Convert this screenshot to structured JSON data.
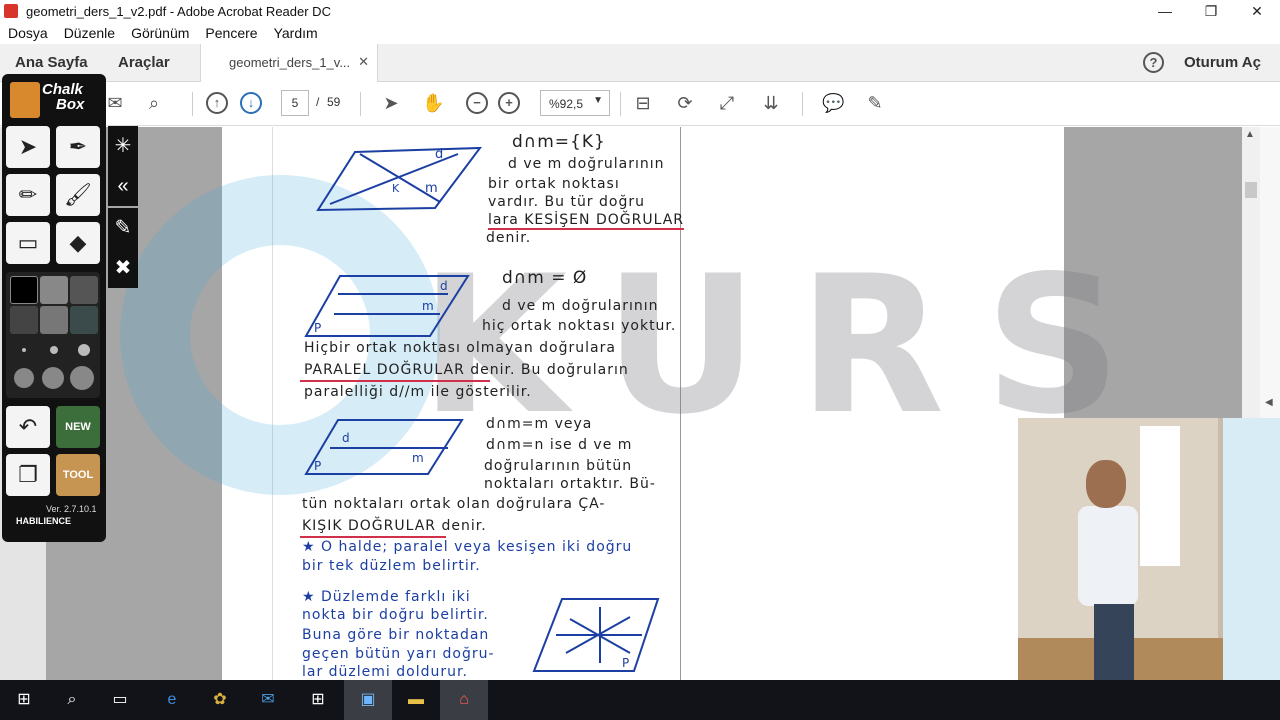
{
  "window": {
    "title": "geometri_ders_1_v2.pdf - Adobe Acrobat Reader DC",
    "controls": [
      "—",
      "❐",
      "✕"
    ]
  },
  "menu": [
    "Dosya",
    "Düzenle",
    "Görünüm",
    "Pencere",
    "Yardım"
  ],
  "tabs": {
    "home": "Ana Sayfa",
    "tools": "Araçlar",
    "document": "geometri_ders_1_v...",
    "help": "?",
    "sign_in": "Oturum Aç"
  },
  "toolbar": {
    "page_current": "5",
    "page_separator": "/",
    "page_total": "59",
    "zoom": "%92,5"
  },
  "document": {
    "watermark": "KURS",
    "notes": [
      {
        "text": "d∩m={K}"
      },
      {
        "text": "d ve m doğrularının"
      },
      {
        "text": "bir ortak noktası"
      },
      {
        "text": "vardır. Bu tür doğru"
      },
      {
        "text": "lara KESİŞEN DOĞRULAR"
      },
      {
        "text": "denir."
      },
      {
        "text": "d∩m = Ø"
      },
      {
        "text": "d ve m doğrularının"
      },
      {
        "text": "hiç ortak noktası yoktur."
      },
      {
        "text": "Hiçbir ortak noktası olmayan doğrulara"
      },
      {
        "text": "PARALEL DOĞRULAR denir. Bu doğruların"
      },
      {
        "text": "paralelliği d//m ile gösterilir."
      },
      {
        "text": "d∩m=m veya"
      },
      {
        "text": "d∩m=n ise d ve m"
      },
      {
        "text": "doğrularının bütün"
      },
      {
        "text": "noktaları ortaktır. Bü-"
      },
      {
        "text": "tün noktaları ortak olan doğrulara ÇA-"
      },
      {
        "text": "KIŞIK DOĞRULAR denir."
      },
      {
        "text": "★ O halde; paralel veya kesişen iki doğru"
      },
      {
        "text": "bir tek düzlem belirtir."
      },
      {
        "text": "★ Düzlemde farklı iki"
      },
      {
        "text": "nokta bir doğru belirtir."
      },
      {
        "text": "Buna göre bir noktadan"
      },
      {
        "text": "geçen bütün yarı doğru-"
      },
      {
        "text": "lar düzlemi doldurur."
      }
    ]
  },
  "chalkbox": {
    "title_line1": "Chalk",
    "title_line2": "Box",
    "version": "Ver. 2.7.10.1",
    "brand": "HABILIENCE",
    "new_label": "NEW",
    "tool_label": "TOOL"
  },
  "colors": {
    "ink_blue": "#1c3fa3",
    "underline_red": "#d0304a",
    "acrobat_red": "#d9342b"
  }
}
